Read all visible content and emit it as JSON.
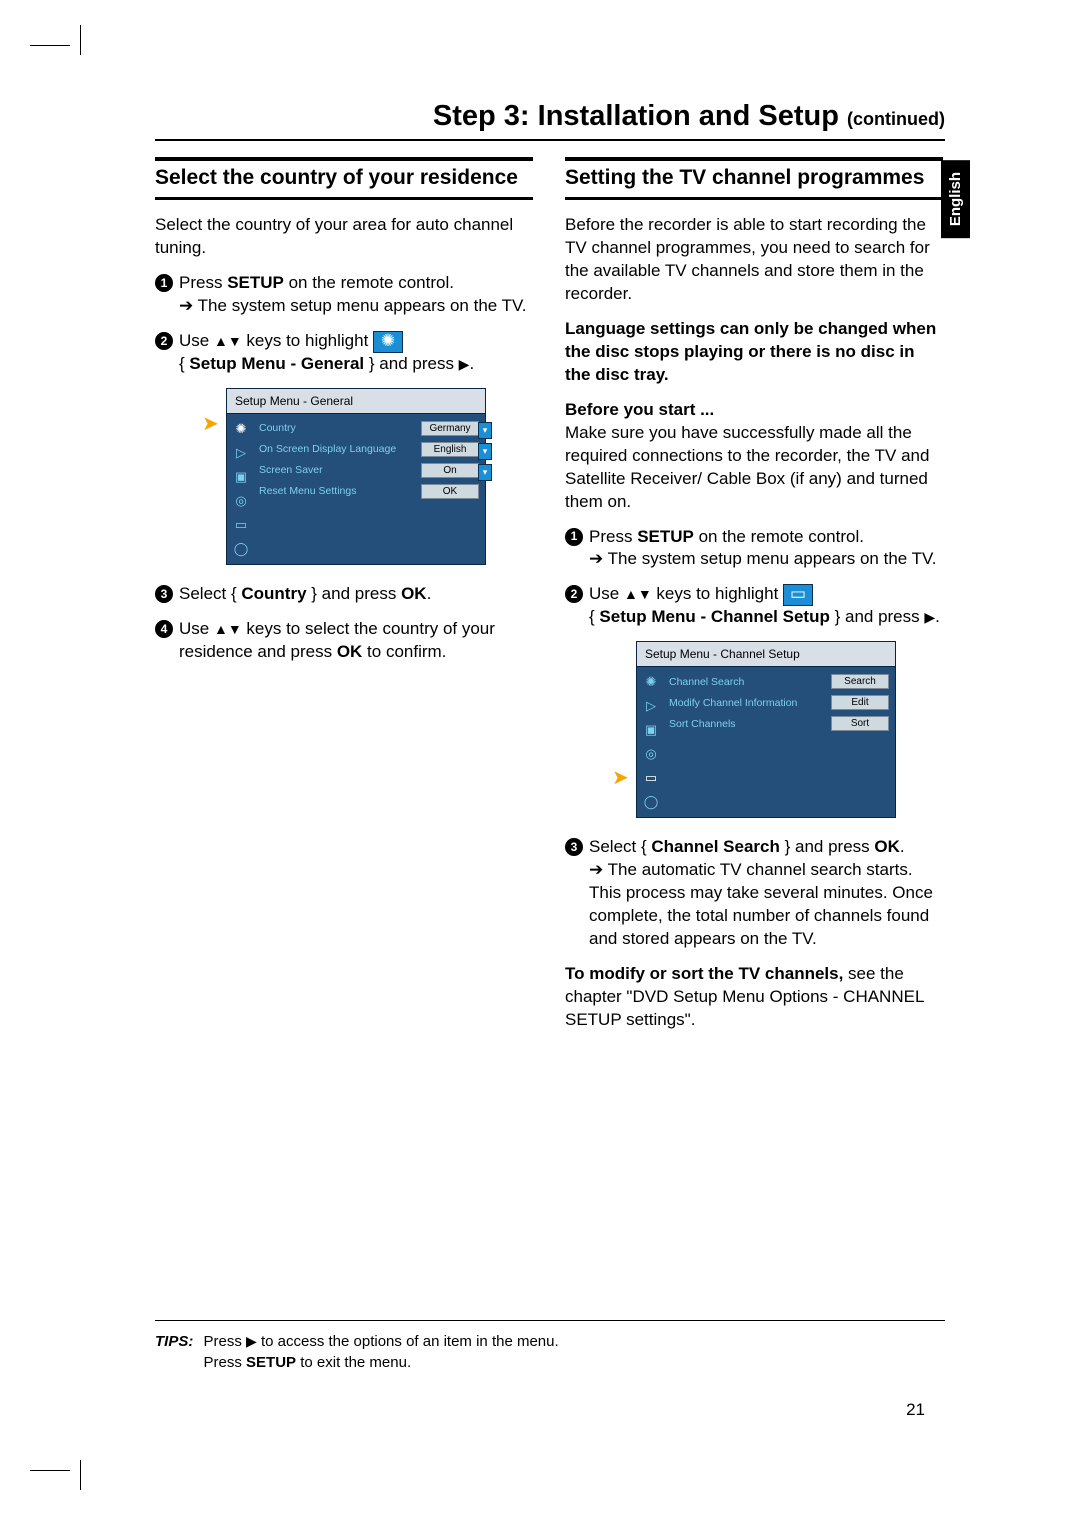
{
  "page_number": "21",
  "language_tab": "English",
  "title_main": "Step 3: Installation and Setup",
  "title_cont": "(continued)",
  "left": {
    "heading": "Select the country of your residence",
    "intro": "Select the country of your area for auto channel tuning.",
    "step1_a": "Press ",
    "step1_setup": "SETUP",
    "step1_b": " on the remote control.",
    "step1_result": "The system setup menu appears on the TV.",
    "step2_a": "Use ",
    "step2_b": " keys to highlight ",
    "step2_c_open": "{ ",
    "step2_c_bold": "Setup Menu - General",
    "step2_c_close": " } and press ",
    "step3_a": "Select { ",
    "step3_bold": "Country",
    "step3_b": " } and press ",
    "step3_ok": "OK",
    "step3_c": ".",
    "step4_a": "Use ",
    "step4_b": " keys to select the country of your residence and press ",
    "step4_ok": "OK",
    "step4_c": " to confirm."
  },
  "right": {
    "heading": "Setting the TV channel programmes",
    "intro": "Before the recorder is able to start recording the TV channel programmes, you need to search for the available TV channels and store them in the recorder.",
    "note": "Language settings can only be changed when the disc stops playing or there is no disc in the disc tray.",
    "before_label": "Before you start ...",
    "before_text": "Make sure you have successfully made all the required connections to the recorder, the TV and Satellite Receiver/ Cable Box (if any) and turned them on.",
    "step1_a": "Press ",
    "step1_setup": "SETUP",
    "step1_b": " on the remote control.",
    "step1_result": "The system setup menu appears on the TV.",
    "step2_a": "Use ",
    "step2_b": " keys to highlight ",
    "step2_c_open": "{ ",
    "step2_c_bold": "Setup Menu - Channel Setup",
    "step2_c_close": " } and press ",
    "step3_a": "Select { ",
    "step3_bold": "Channel Search",
    "step3_b": " } and press ",
    "step3_ok": "OK",
    "step3_c": ".",
    "step3_result": "The automatic TV channel search starts. This process may take several minutes. Once complete, the total number of channels found and stored appears on the TV.",
    "modify_label": "To modify or sort the TV channels,",
    "modify_text": " see the chapter \"DVD Setup Menu Options - CHANNEL SETUP settings\"."
  },
  "menu_general": {
    "header": "Setup Menu - General",
    "rows": [
      {
        "label": "Country",
        "value": "Germany",
        "dropdown": true
      },
      {
        "label": "On Screen Display Language",
        "value": "English",
        "dropdown": true
      },
      {
        "label": "Screen Saver",
        "value": "On",
        "dropdown": true
      },
      {
        "label": "Reset Menu Settings",
        "value": "OK",
        "dropdown": false
      }
    ]
  },
  "menu_channel": {
    "header": "Setup Menu - Channel Setup",
    "rows": [
      {
        "label": "Channel Search",
        "value": "Search",
        "dropdown": false
      },
      {
        "label": "Modify Channel Information",
        "value": "Edit",
        "dropdown": false
      },
      {
        "label": "Sort Channels",
        "value": "Sort",
        "dropdown": false
      }
    ]
  },
  "tips": {
    "label": "TIPS:",
    "line1_a": "Press ",
    "line1_b": " to access the options of an item in the menu.",
    "line2_a": "Press ",
    "line2_bold": "SETUP",
    "line2_b": " to exit the menu."
  }
}
